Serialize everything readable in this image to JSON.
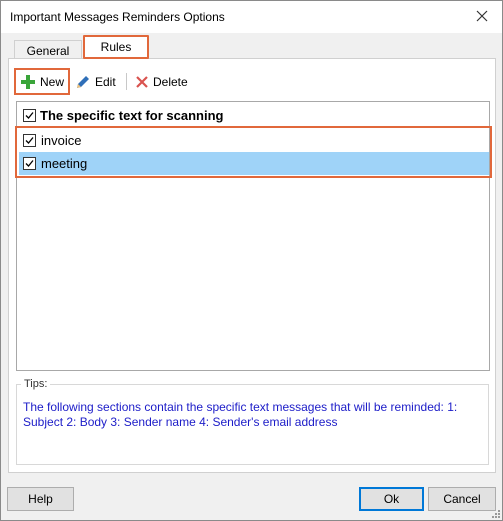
{
  "window": {
    "title": "Important Messages Reminders Options"
  },
  "tabs": [
    {
      "label": "General",
      "active": false
    },
    {
      "label": "Rules",
      "active": true
    }
  ],
  "toolbar": {
    "new_label": "New",
    "edit_label": "Edit",
    "delete_label": "Delete"
  },
  "list": {
    "header": {
      "label": "The specific text for scanning",
      "checked": true
    },
    "items": [
      {
        "label": "invoice",
        "checked": true,
        "selected": false
      },
      {
        "label": "meeting",
        "checked": true,
        "selected": true
      }
    ]
  },
  "tips": {
    "label": "Tips:",
    "text": "The following sections contain the specific text messages that will be reminded: 1: Subject 2: Body 3: Sender name 4: Sender's email address"
  },
  "buttons": {
    "help": "Help",
    "ok": "Ok",
    "cancel": "Cancel"
  },
  "colors": {
    "highlight_border": "#e1683b",
    "selection": "#9fd3f8",
    "tips_text": "#1c1cc8",
    "new_icon": "#3aa53a",
    "delete_icon": "#d9534f",
    "edit_icon": "#2f6fb8"
  }
}
